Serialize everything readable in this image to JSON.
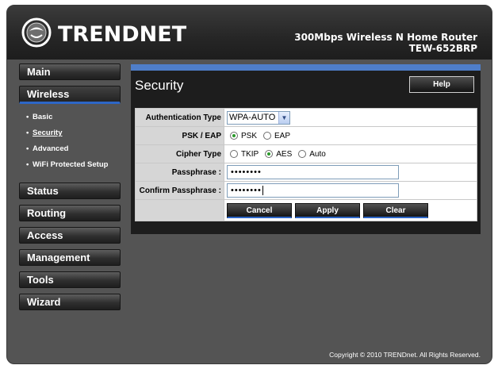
{
  "header": {
    "brand": "TRENDNET",
    "product_line": "300Mbps Wireless N Home Router",
    "model": "TEW-652BRP"
  },
  "sidebar": {
    "main": "Main",
    "wireless": "Wireless",
    "wireless_sub": [
      {
        "label": "Basic"
      },
      {
        "label": "Security"
      },
      {
        "label": "Advanced"
      },
      {
        "label": "WiFi Protected Setup"
      }
    ],
    "status": "Status",
    "routing": "Routing",
    "access": "Access",
    "management": "Management",
    "tools": "Tools",
    "wizard": "Wizard"
  },
  "page": {
    "title": "Security",
    "help": "Help"
  },
  "form": {
    "auth_label": "Authentication Type",
    "auth_value": "WPA-AUTO",
    "psk_eap_label": "PSK / EAP",
    "psk": "PSK",
    "eap": "EAP",
    "cipher_label": "Cipher Type",
    "tkip": "TKIP",
    "aes": "AES",
    "auto": "Auto",
    "passphrase_label": "Passphrase :",
    "passphrase_value": "••••••••",
    "confirm_label": "Confirm Passphrase :",
    "confirm_value": "••••••••",
    "cancel": "Cancel",
    "apply": "Apply",
    "clear": "Clear"
  },
  "footer": {
    "copyright": "Copyright © 2010 TRENDnet. All Rights Reserved."
  },
  "colors": {
    "accent": "#2d66c6",
    "panel_bar": "#4f7ec9",
    "radio_checked": "#2b9a2b"
  }
}
